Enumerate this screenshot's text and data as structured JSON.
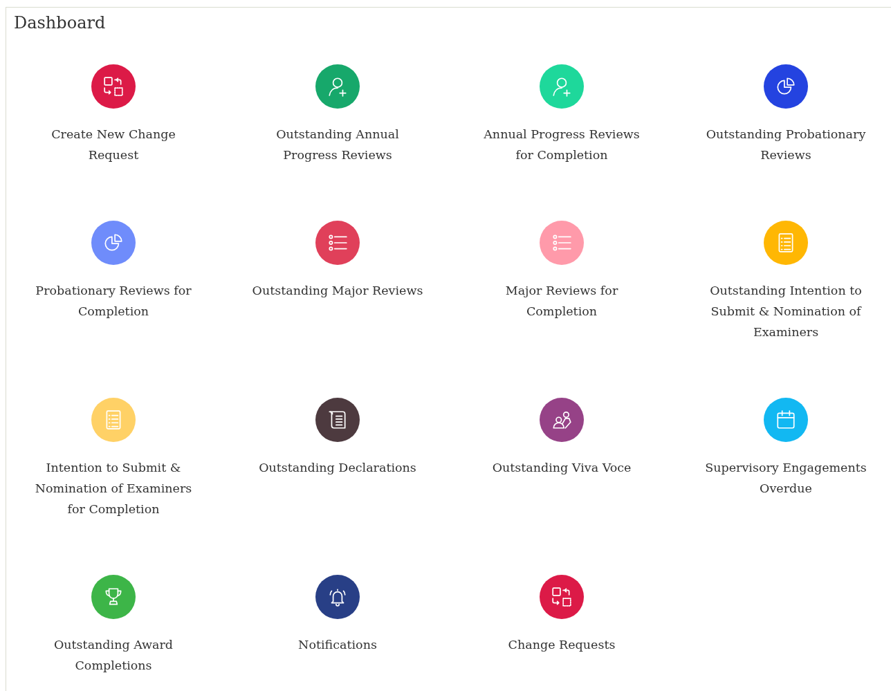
{
  "title": "Dashboard",
  "tiles": [
    {
      "label": "Create New Change Request",
      "color": "#dc1a47"
    },
    {
      "label": "Outstanding Annual Progress Reviews",
      "color": "#17a86b"
    },
    {
      "label": "Annual Progress Reviews for Completion",
      "color": "#1ed89b"
    },
    {
      "label": "Outstanding Probationary Reviews",
      "color": "#2443e0"
    },
    {
      "label": "Probationary Reviews for Completion",
      "color": "#6f8cfb"
    },
    {
      "label": "Outstanding Major Reviews",
      "color": "#e0405a"
    },
    {
      "label": "Major Reviews for Completion",
      "color": "#ff9aaa"
    },
    {
      "label": "Outstanding Intention to Submit & Nomination of Examiners",
      "color": "#ffb703"
    },
    {
      "label": "Intention to Submit & Nomination of Examiners for Completion",
      "color": "#ffd166"
    },
    {
      "label": "Outstanding Declarations",
      "color": "#4d3a3f"
    },
    {
      "label": "Outstanding Viva Voce",
      "color": "#964287"
    },
    {
      "label": "Supervisory Engagements Overdue",
      "color": "#12b8f2"
    },
    {
      "label": "Outstanding Award Completions",
      "color": "#3db548"
    },
    {
      "label": "Notifications",
      "color": "#283f86"
    },
    {
      "label": "Change Requests",
      "color": "#dc1a47"
    }
  ]
}
